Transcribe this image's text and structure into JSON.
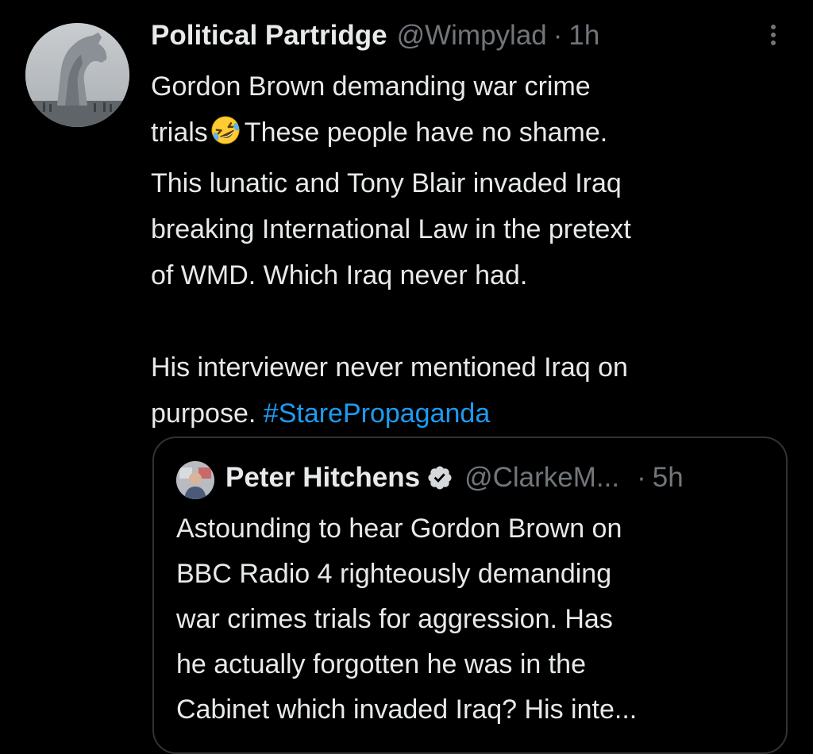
{
  "tweet": {
    "author_name": "Political Partridge",
    "author_handle": "@Wimpylad",
    "separator": "·",
    "time": "1h",
    "avatar_icon": "kelpies-horse-sculpture-photo",
    "more_icon": "more-vertical-icon",
    "text_lines": [
      "Gordon Brown demanding war crime",
      "trials",
      "These people have no shame.",
      "This lunatic and Tony Blair invaded Iraq",
      "breaking International Law in the pretext",
      "of WMD. Which Iraq never had.",
      "His interviewer never mentioned Iraq on",
      "purpose.",
      "#StarePropaganda"
    ],
    "emoji": "rolling-on-floor-laughing-emoji",
    "hashtag_color": "#1d9bf0"
  },
  "quoted_tweet": {
    "author_name": "Peter Hitchens",
    "verified_icon": "verified-badge-icon",
    "author_handle": "@ClarkeM...",
    "separator": "·",
    "time": "5h",
    "text_lines": [
      "Astounding to hear Gordon Brown on",
      "BBC Radio 4 righteously demanding",
      "war crimes trials for aggression. Has",
      "he actually forgotten he was in the",
      "Cabinet which invaded Iraq? His inte..."
    ]
  },
  "colors": {
    "background": "#000000",
    "primary_text": "#e7e9ea",
    "secondary_text": "#71767b",
    "border": "#2f3336",
    "link": "#1d9bf0"
  }
}
